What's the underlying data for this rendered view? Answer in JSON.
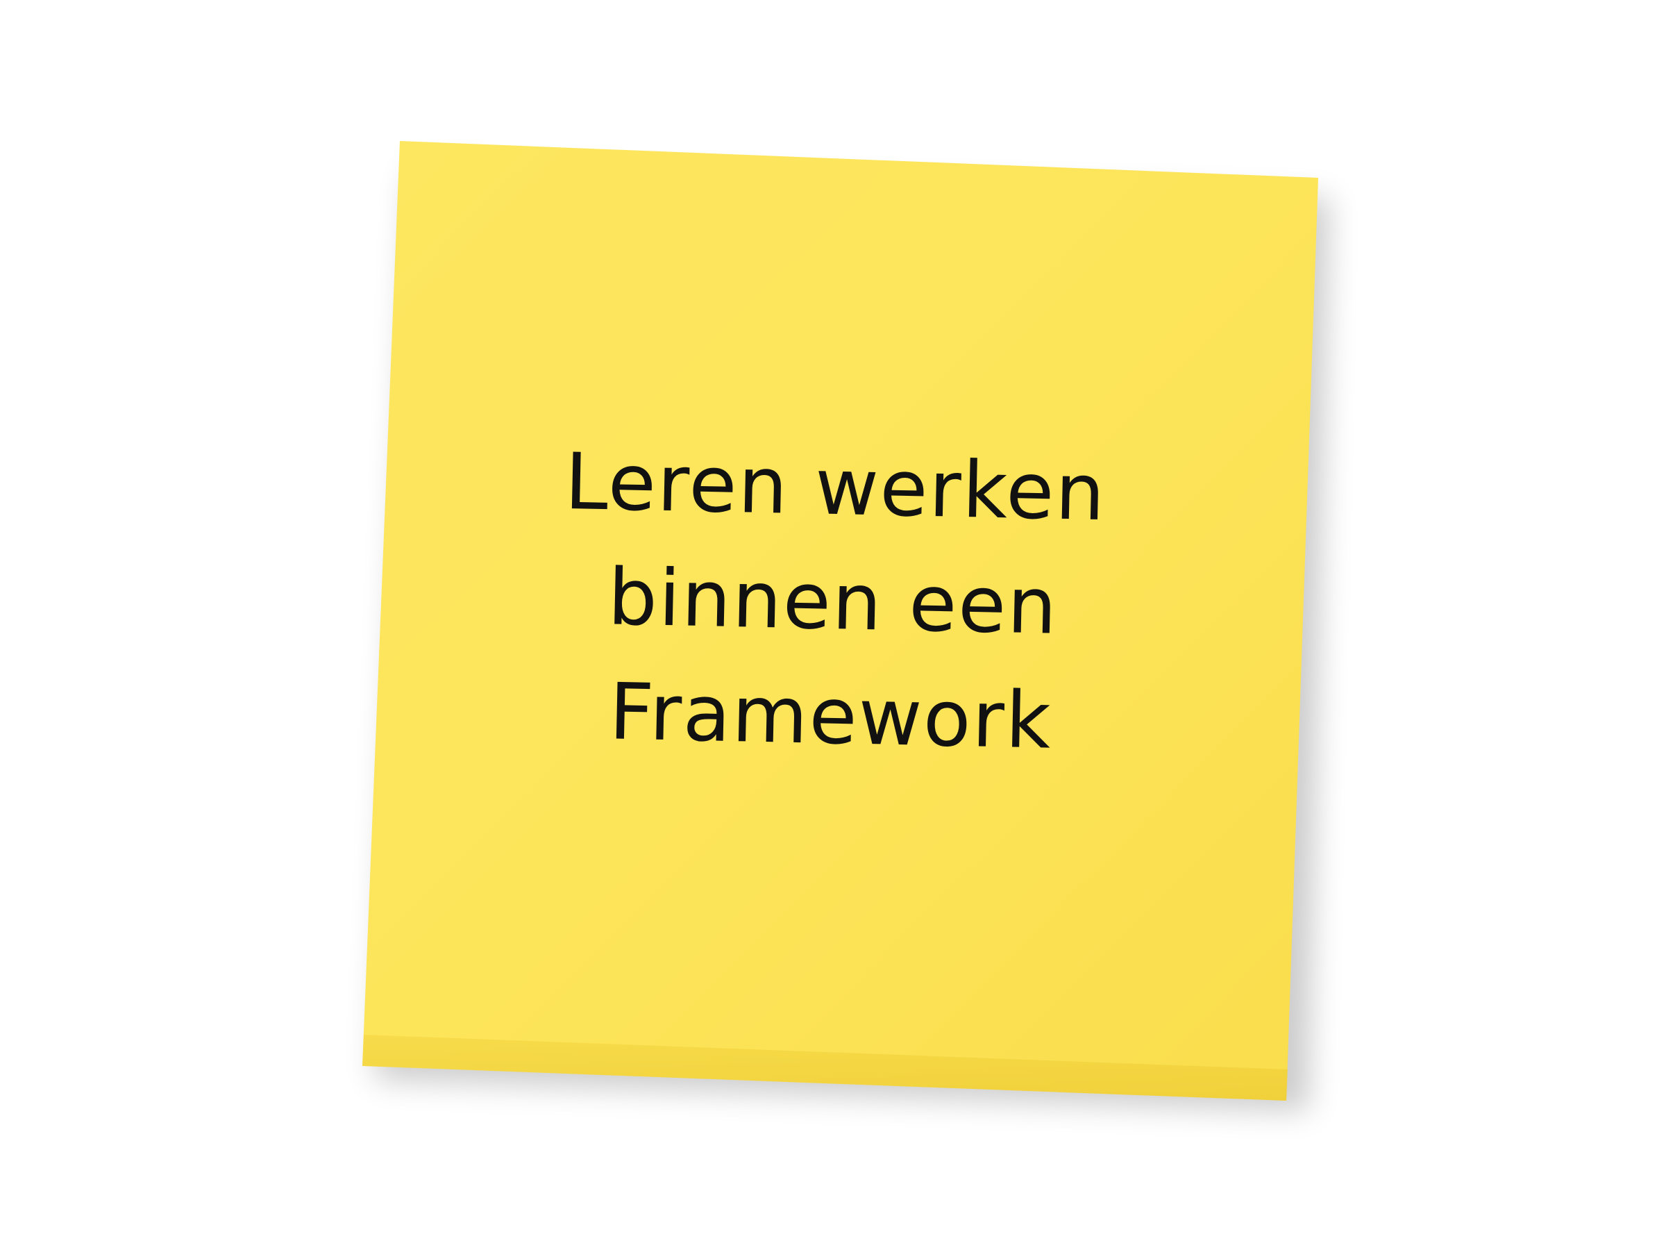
{
  "note": {
    "lines": [
      "Leren werken",
      "binnen een",
      "Framework"
    ],
    "paper_color": "#fde65c",
    "ink_color": "#111111",
    "background_color": "#ffffff"
  }
}
